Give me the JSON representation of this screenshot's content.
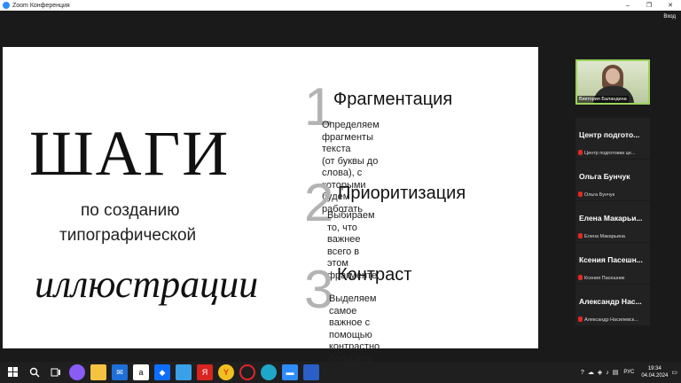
{
  "window": {
    "title": "Zoom Конференция",
    "minimize": "‒",
    "maximize": "❐",
    "close": "✕"
  },
  "meeting": {
    "view_label": "Вход"
  },
  "slide": {
    "title": "ШАГИ",
    "subtitle_line1": "по созданию",
    "subtitle_line2": "типографической",
    "script_word": "иллюстрации",
    "steps": [
      {
        "num": "1",
        "title": "Фрагментация",
        "desc": "Определяем фрагменты текста\n(от буквы до слова), с которыми\nбудем работать"
      },
      {
        "num": "2",
        "title": "Приоритизация",
        "desc": "Выбираем то, что важнее всего в\nэтом фрагменте"
      },
      {
        "num": "3",
        "title": "Контраст",
        "desc": "Выделяем самое важное с\nпомощью контрастно большего\nразмера, шрифта или цвета."
      }
    ]
  },
  "participants": {
    "self": {
      "name": "Виктория Баландина"
    },
    "list": [
      {
        "name": "Центр подгото...",
        "sub": "Центр подготовки це..."
      },
      {
        "name": "Ольга Бунчук",
        "sub": "Ольга Бунчук"
      },
      {
        "name": "Елена Макарьи...",
        "sub": "Елена Макарьина"
      },
      {
        "name": "Ксения Пасешн...",
        "sub": "Ксения Пасешник"
      },
      {
        "name": "Александр Нас...",
        "sub": "Александр Насилевск..."
      }
    ]
  },
  "taskbar": {
    "icons": [
      "windows-icon",
      "search-icon",
      "task-view-icon",
      "alice-icon",
      "file-explorer-icon",
      "mail-icon",
      "amazon-icon",
      "dropbox-icon",
      "misc-icon",
      "yandex-icon",
      "yandex-browser-icon",
      "opera-icon",
      "edge-icon",
      "zoom-icon",
      "office-icon"
    ],
    "lang": "РУС",
    "time": "19:34",
    "date": "04.04.2024"
  },
  "colors": {
    "accent": "#2d8cff",
    "active_border": "#9bd35a",
    "muted_mic": "#e02828",
    "step_number": "#b3b3b3"
  }
}
